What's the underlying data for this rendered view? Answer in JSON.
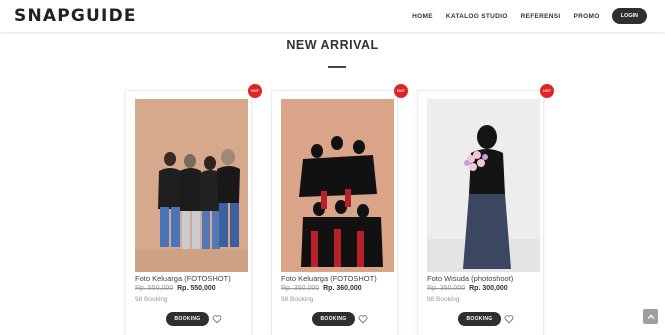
{
  "brand": {
    "logo_text": "SNAPGUIDE"
  },
  "nav": {
    "items": [
      {
        "label": "HOME"
      },
      {
        "label": "KATALOG STUDIO"
      },
      {
        "label": "REFERENSI"
      },
      {
        "label": "PROMO"
      }
    ],
    "login_label": "LOGIN"
  },
  "section": {
    "title": "NEW ARRIVAL"
  },
  "products": [
    {
      "badge": "HOT",
      "name": "Foto Keluarga (FOTOSHOT)",
      "old_price": "Rp. 550,000",
      "new_price": "Rp. 550,000",
      "booked": "98 Booking",
      "button_label": "BOOKING",
      "photo_background": "#d6a98c"
    },
    {
      "badge": "HOT",
      "name": "Foto Keluarga (FOTOSHOT)",
      "old_price": "Rp. 350,000",
      "new_price": "Rp. 360,000",
      "booked": "98 Booking",
      "button_label": "BOOKING",
      "photo_background": "#d9a488"
    },
    {
      "badge": "HOT",
      "name": "Foto Wisuda (photoshoot)",
      "old_price": "Rp. 350,000",
      "new_price": "Rp. 300,000",
      "booked": "98 Booking",
      "button_label": "BOOKING",
      "photo_background": "#ededed"
    }
  ],
  "colors": {
    "accent_dark": "#2f2f2f",
    "badge_red": "#e02424",
    "scroll_button": "#9e9e9e"
  },
  "icons": {
    "heart": "heart-outline-icon",
    "scroll_top": "chevron-up-icon"
  }
}
